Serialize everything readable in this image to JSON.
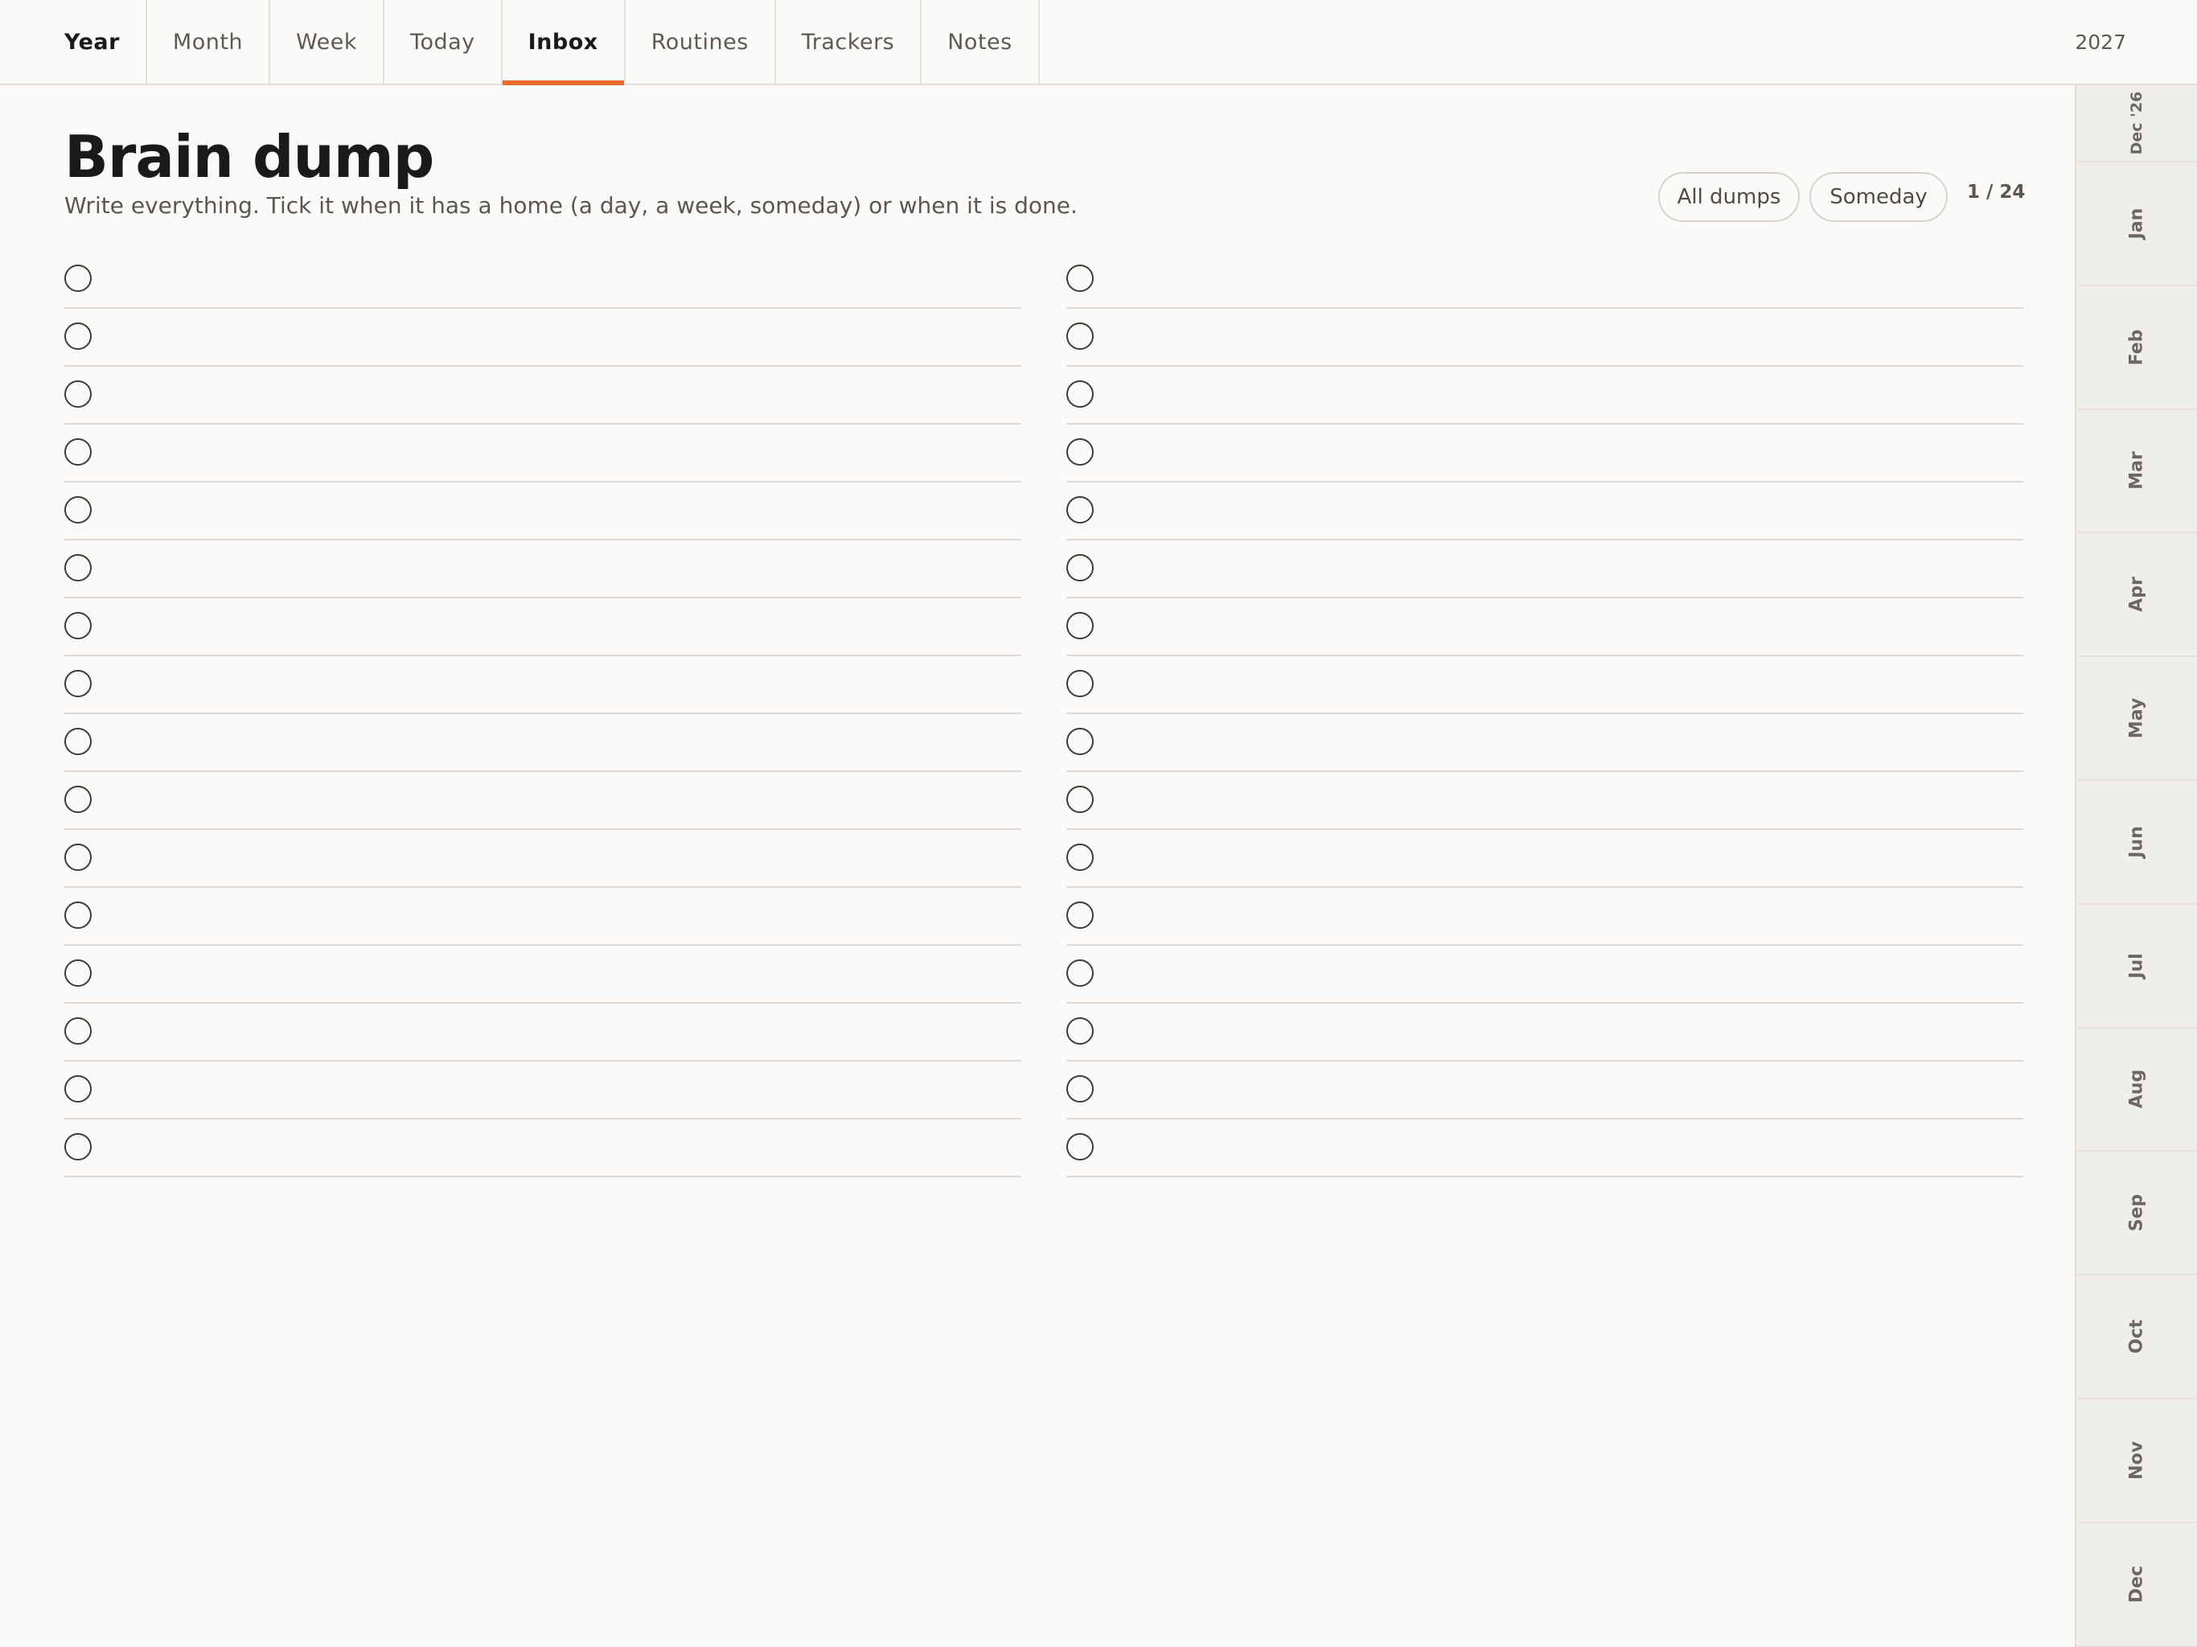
{
  "nav": {
    "tabs": [
      {
        "label": "Year"
      },
      {
        "label": "Month"
      },
      {
        "label": "Week"
      },
      {
        "label": "Today"
      },
      {
        "label": "Inbox"
      },
      {
        "label": "Routines"
      },
      {
        "label": "Trackers"
      },
      {
        "label": "Notes"
      }
    ],
    "active_tab": "Inbox",
    "year": "2027"
  },
  "header": {
    "title": "Brain dump",
    "subtitle": "Write everything. Tick it when it has a home (a day, a week, someday) or when it is done.",
    "filters": [
      "All dumps",
      "Someday"
    ],
    "page_indicator": "1 / 24"
  },
  "rail": {
    "months": [
      "Dec '26",
      "Jan",
      "Feb",
      "Mar",
      "Apr",
      "May",
      "Jun",
      "Jul",
      "Aug",
      "Sep",
      "Oct",
      "Nov",
      "Dec"
    ]
  },
  "lists": {
    "left_rows": 16,
    "right_rows": 16
  },
  "colors": {
    "accent": "#ec6a2c",
    "background": "#fbfaf8",
    "rail_background": "#f0eeea"
  }
}
